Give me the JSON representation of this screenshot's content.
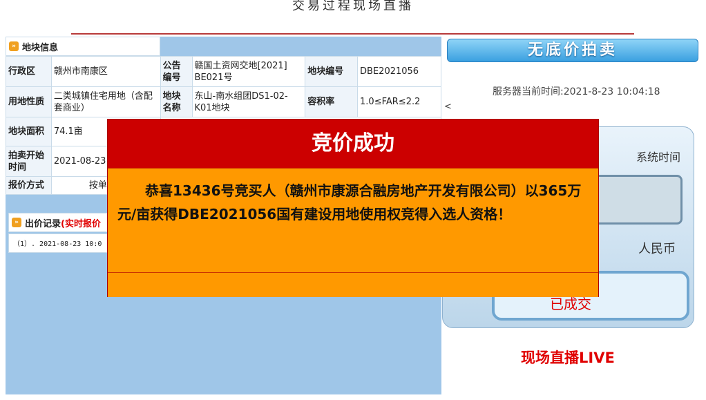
{
  "header": {
    "title": "交易过程现场直播"
  },
  "land_info": {
    "section_title": "地块信息",
    "rows": [
      {
        "l1": "行政区",
        "v1": "赣州市南康区",
        "l2": "公告编号",
        "v2": "赣国土资网交地[2021] BE021号",
        "l3": "地块编号",
        "v3": "DBE2021056"
      },
      {
        "l1": "用地性质",
        "v1": "二类城镇住宅用地（含配套商业）",
        "l2": "地块名称",
        "v2": "东山-南水组团DS1-02-K01地块",
        "l3": "容积率",
        "v3": "1.0≤FAR≤2.2"
      },
      {
        "l1": "地块面积",
        "v1": "74.1亩"
      },
      {
        "l1": "拍卖开始时间",
        "v1": "2021-08-23"
      },
      {
        "l1": "报价方式",
        "v1": "按单"
      }
    ]
  },
  "bid_record": {
    "title_prefix": "出价记录",
    "title_live": "(实时报价",
    "entry": "（1）. 2021-08-23 10:0"
  },
  "auction": {
    "banner": "无底价拍卖",
    "server_time_label": "服务器当前时间:2021-8-23 10:04:18",
    "lt_mark": "<",
    "sys_time_label": "系统时间",
    "currency_label": "人民币",
    "status_partial": "已成交",
    "live_label": "现场直播LIVE"
  },
  "modal": {
    "title": "竞价成功",
    "message": "恭喜13436号竞买人（赣州市康源合融房地产开发有限公司）以365万元/亩获得DBE2021056国有建设用地使用权竞得入选人资格！"
  },
  "colors": {
    "modal_header": "#cc0000",
    "modal_body": "#ff9900",
    "panel_bg": "#9fc6e8",
    "accent_red": "#e00000"
  }
}
